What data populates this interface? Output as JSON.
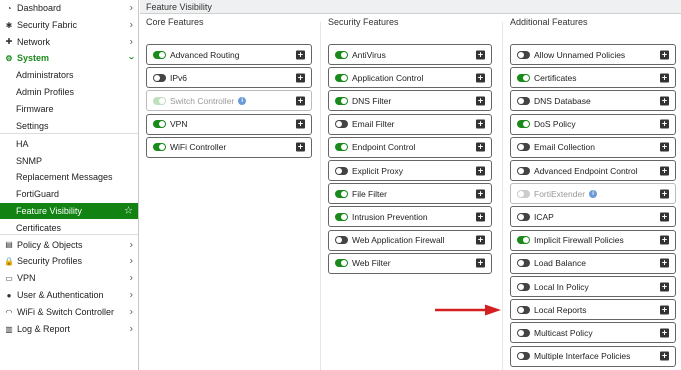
{
  "sidebar": {
    "items": [
      {
        "label": "Dashboard",
        "icon": "dashboard-icon",
        "glyph": "◔",
        "chev": "›"
      },
      {
        "label": "Security Fabric",
        "icon": "security-fabric-icon",
        "glyph": "✱",
        "chev": "›"
      },
      {
        "label": "Network",
        "icon": "network-icon",
        "glyph": "✚",
        "chev": "›"
      },
      {
        "label": "System",
        "icon": "gear-icon",
        "glyph": "⚙",
        "chev": "›"
      },
      {
        "label": "Administrators"
      },
      {
        "label": "Admin Profiles"
      },
      {
        "label": "Firmware"
      },
      {
        "label": "Settings"
      },
      {
        "label": "HA"
      },
      {
        "label": "SNMP"
      },
      {
        "label": "Replacement Messages"
      },
      {
        "label": "FortiGuard"
      },
      {
        "label": "Feature Visibility",
        "chev": "☆"
      },
      {
        "label": "Certificates"
      },
      {
        "label": "Policy & Objects",
        "icon": "policy-icon",
        "glyph": "▤",
        "chev": "›"
      },
      {
        "label": "Security Profiles",
        "icon": "lock-icon",
        "glyph": "🔒",
        "chev": "›"
      },
      {
        "label": "VPN",
        "icon": "vpn-icon",
        "glyph": "▭",
        "chev": "›"
      },
      {
        "label": "User & Authentication",
        "icon": "user-icon",
        "glyph": "●",
        "chev": "›"
      },
      {
        "label": "WiFi & Switch Controller",
        "icon": "wifi-icon",
        "glyph": "◠",
        "chev": "›"
      },
      {
        "label": "Log & Report",
        "icon": "chart-icon",
        "glyph": "▥",
        "chev": "›"
      }
    ]
  },
  "page_title": "Feature Visibility",
  "columns": [
    {
      "title": "Core Features",
      "items": [
        {
          "label": "Advanced Routing",
          "state": "on"
        },
        {
          "label": "IPv6",
          "state": "off"
        },
        {
          "label": "Switch Controller",
          "state": "disabled-on",
          "info": "i"
        },
        {
          "label": "VPN",
          "state": "on"
        },
        {
          "label": "WiFi Controller",
          "state": "on"
        }
      ]
    },
    {
      "title": "Security Features",
      "items": [
        {
          "label": "AntiVirus",
          "state": "on"
        },
        {
          "label": "Application Control",
          "state": "on"
        },
        {
          "label": "DNS Filter",
          "state": "on"
        },
        {
          "label": "Email Filter",
          "state": "off"
        },
        {
          "label": "Endpoint Control",
          "state": "on"
        },
        {
          "label": "Explicit Proxy",
          "state": "off"
        },
        {
          "label": "File Filter",
          "state": "on"
        },
        {
          "label": "Intrusion Prevention",
          "state": "on"
        },
        {
          "label": "Web Application Firewall",
          "state": "off"
        },
        {
          "label": "Web Filter",
          "state": "on"
        }
      ]
    },
    {
      "title": "Additional Features",
      "items": [
        {
          "label": "Allow Unnamed Policies",
          "state": "off"
        },
        {
          "label": "Certificates",
          "state": "on"
        },
        {
          "label": "DNS Database",
          "state": "off"
        },
        {
          "label": "DoS Policy",
          "state": "on"
        },
        {
          "label": "Email Collection",
          "state": "off"
        },
        {
          "label": "Advanced Endpoint Control",
          "state": "off"
        },
        {
          "label": "FortiExtender",
          "state": "disabled-off",
          "info": "i"
        },
        {
          "label": "ICAP",
          "state": "off"
        },
        {
          "label": "Implicit Firewall Policies",
          "state": "on"
        },
        {
          "label": "Load Balance",
          "state": "off"
        },
        {
          "label": "Local In Policy",
          "state": "off"
        },
        {
          "label": "Local Reports",
          "state": "off"
        },
        {
          "label": "Multicast Policy",
          "state": "off"
        },
        {
          "label": "Multiple Interface Policies",
          "state": "off"
        }
      ]
    }
  ],
  "plus_glyph": "+",
  "colors": {
    "accent_green": "#128212",
    "toggle_on": "#1a8a1a",
    "arrow_red": "#d42020"
  }
}
